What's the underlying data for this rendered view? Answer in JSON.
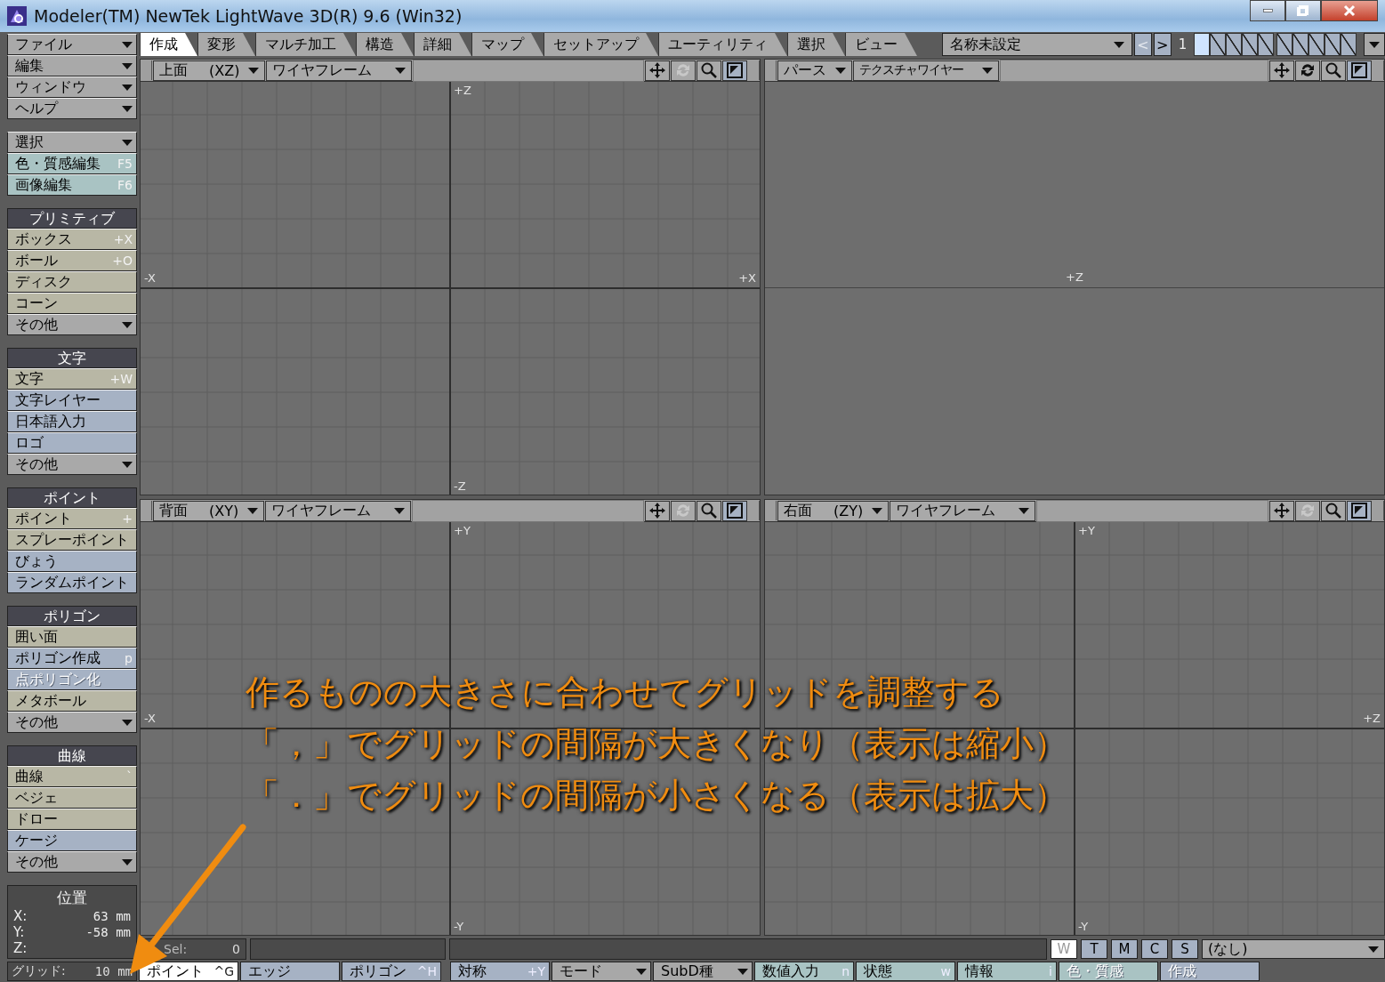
{
  "window": {
    "title": "Modeler(TM) NewTek LightWave 3D(R) 9.6  (Win32)"
  },
  "tabs": [
    {
      "label": "作成",
      "selected": true
    },
    {
      "label": "変形",
      "selected": false
    },
    {
      "label": "マルチ加工",
      "selected": false
    },
    {
      "label": "構造",
      "selected": false
    },
    {
      "label": "詳細",
      "selected": false
    },
    {
      "label": "マップ",
      "selected": false
    },
    {
      "label": "セットアップ",
      "selected": false
    },
    {
      "label": "ユーティリティ",
      "selected": false
    },
    {
      "label": "選択",
      "selected": false
    },
    {
      "label": "ビュー",
      "selected": false
    }
  ],
  "object_menu": {
    "value": "名称未設定"
  },
  "layer_nav": {
    "prev": "<",
    "next": ">",
    "bank": "1"
  },
  "layers": [
    {
      "selected": true
    },
    {
      "selected": false
    },
    {
      "selected": false
    },
    {
      "selected": false
    },
    {
      "selected": false
    },
    {
      "selected": false
    },
    {
      "selected": false
    },
    {
      "selected": false
    },
    {
      "selected": false
    },
    {
      "selected": false
    }
  ],
  "sidebar": {
    "groups": [
      {
        "items": [
          {
            "label": "ファイル",
            "kind": "menu",
            "disabled": false
          },
          {
            "label": "編集",
            "kind": "menu",
            "disabled": false
          },
          {
            "label": "ウィンドウ",
            "kind": "menu",
            "disabled": false
          },
          {
            "label": "ヘルプ",
            "kind": "menu",
            "disabled": false
          }
        ]
      },
      {
        "items": [
          {
            "label": "選択",
            "kind": "menu",
            "disabled": false
          },
          {
            "label": "色・質感編集",
            "shortcut": "F5",
            "kind": "tool",
            "color": "#a9c3c3",
            "disabled": false
          },
          {
            "label": "画像編集",
            "shortcut": "F6",
            "kind": "tool",
            "color": "#a9c3c3",
            "disabled": false
          }
        ]
      },
      {
        "header": "プリミティブ",
        "items": [
          {
            "label": "ボックス",
            "shortcut": "+X",
            "kind": "tool",
            "color": "#b8b7a5",
            "disabled": false
          },
          {
            "label": "ボール",
            "shortcut": "+O",
            "kind": "tool",
            "color": "#b8b7a5",
            "disabled": false
          },
          {
            "label": "ディスク",
            "kind": "tool",
            "color": "#b8b7a5",
            "disabled": false
          },
          {
            "label": "コーン",
            "kind": "tool",
            "color": "#b8b7a5",
            "disabled": false
          },
          {
            "label": "その他",
            "kind": "menu",
            "disabled": false
          }
        ]
      },
      {
        "header": "文字",
        "items": [
          {
            "label": "文字",
            "shortcut": "+W",
            "kind": "tool",
            "color": "#b8b7a5",
            "disabled": false
          },
          {
            "label": "文字レイヤー",
            "kind": "tool",
            "color": "#a6b2c4",
            "disabled": false
          },
          {
            "label": "日本語入力",
            "kind": "tool",
            "color": "#a6b2c4",
            "disabled": false
          },
          {
            "label": "ロゴ",
            "kind": "tool",
            "color": "#a6b2c4",
            "disabled": false
          },
          {
            "label": "その他",
            "kind": "menu",
            "disabled": false
          }
        ]
      },
      {
        "header": "ポイント",
        "items": [
          {
            "label": "ポイント",
            "shortcut": "+",
            "kind": "tool",
            "color": "#b8b7a5",
            "disabled": false
          },
          {
            "label": "スプレーポイント",
            "kind": "tool",
            "color": "#b8b7a5",
            "disabled": false
          },
          {
            "label": "びょう",
            "kind": "tool",
            "color": "#a6b2c4",
            "disabled": false
          },
          {
            "label": "ランダムポイント",
            "kind": "tool",
            "color": "#a6b2c4",
            "disabled": false
          }
        ]
      },
      {
        "header": "ポリゴン",
        "items": [
          {
            "label": "囲い面",
            "kind": "tool",
            "color": "#b8b7a5",
            "disabled": false
          },
          {
            "label": "ポリゴン作成",
            "shortcut": "p",
            "kind": "tool",
            "color": "#a6b2c4",
            "disabled": false
          },
          {
            "label": "点ポリゴン化",
            "kind": "tool",
            "color": "#a6b2c4",
            "disabled": true
          },
          {
            "label": "メタボール",
            "kind": "tool",
            "color": "#b8b7a5",
            "disabled": false
          },
          {
            "label": "その他",
            "kind": "menu",
            "disabled": false
          }
        ]
      },
      {
        "header": "曲線",
        "items": [
          {
            "label": "曲線",
            "shortcut": "`",
            "kind": "tool",
            "color": "#b8b7a5",
            "disabled": false
          },
          {
            "label": "ベジェ",
            "kind": "tool",
            "color": "#b8b7a5",
            "disabled": false
          },
          {
            "label": "ドロー",
            "kind": "tool",
            "color": "#b8b7a5",
            "disabled": false
          },
          {
            "label": "ケージ",
            "kind": "tool",
            "color": "#a6b2c4",
            "disabled": false
          },
          {
            "label": "その他",
            "kind": "menu",
            "disabled": false
          }
        ]
      }
    ]
  },
  "position": {
    "title": "位置",
    "rows": [
      {
        "axis": "X:",
        "value": "63 mm"
      },
      {
        "axis": "Y:",
        "value": "-58 mm"
      },
      {
        "axis": "Z:"
      }
    ]
  },
  "grid": {
    "label": "グリッド:",
    "value": "10 mm"
  },
  "viewports": [
    {
      "view": "上面",
      "axes": "(XZ)",
      "mode": "ワイヤフレーム",
      "rotate_disabled": true,
      "labels": [
        {
          "text": "+Z",
          "kind": "top"
        },
        {
          "text": "-Z",
          "kind": "bottom"
        },
        {
          "text": "-X",
          "kind": "left"
        },
        {
          "text": "+X",
          "kind": "right"
        }
      ]
    },
    {
      "view": "パース",
      "mode": "テクスチャワイヤー",
      "rotate_disabled": false,
      "labels": [
        {
          "text": "+Z",
          "kind": "center"
        }
      ]
    },
    {
      "view": "背面",
      "axes": "(XY)",
      "mode": "ワイヤフレーム",
      "rotate_disabled": true,
      "labels": [
        {
          "text": "+Y",
          "kind": "top"
        },
        {
          "text": "-Y",
          "kind": "bottom"
        },
        {
          "text": "-X",
          "kind": "left"
        }
      ]
    },
    {
      "view": "右面",
      "axes": "(ZY)",
      "mode": "ワイヤフレーム",
      "rotate_disabled": true,
      "labels": [
        {
          "text": "+Y",
          "kind": "top"
        },
        {
          "text": "-Y",
          "kind": "bottom"
        },
        {
          "text": "+Z",
          "kind": "right"
        }
      ]
    }
  ],
  "status": {
    "sel_label": "Sel:",
    "sel_value": "0",
    "wtmcs": [
      {
        "label": "W",
        "selected": true
      },
      {
        "label": "T",
        "selected": false
      },
      {
        "label": "M",
        "selected": false
      },
      {
        "label": "C",
        "selected": false
      },
      {
        "label": "S",
        "selected": false
      }
    ],
    "surface_menu": "(なし)"
  },
  "modes": [
    {
      "label": "ポイント",
      "shortcut": "^G",
      "selected": true
    },
    {
      "label": "エッジ",
      "selected": false
    },
    {
      "label": "ポリゴン",
      "shortcut": "^H",
      "selected": false
    }
  ],
  "tools": [
    {
      "label": "対称",
      "shortcut": "+Y",
      "kind": "button",
      "color": "#a6b2c4",
      "disabled": false
    },
    {
      "label": "モード",
      "kind": "menu",
      "color": "#a8a8a8",
      "disabled": false
    },
    {
      "label": "SubD種",
      "kind": "menu",
      "color": "#a8a8a8",
      "disabled": false
    },
    {
      "label": "数値入力",
      "shortcut": "n",
      "kind": "button",
      "color": "#a9c3c3",
      "disabled": false
    },
    {
      "label": "状態",
      "shortcut": "w",
      "kind": "button",
      "color": "#a9c3c3",
      "disabled": false
    },
    {
      "label": "情報",
      "shortcut": "i",
      "kind": "button",
      "color": "#a9c3c3",
      "disabled": false
    },
    {
      "label": "色・質感",
      "kind": "button",
      "color": "#a9c3c3",
      "disabled": true
    },
    {
      "label": "作成",
      "kind": "button",
      "color": "#a6b2c4",
      "disabled": true
    }
  ],
  "annotation": {
    "lines": [
      "作るものの大きさに合わせてグリッドを調整する",
      "「，」でグリッドの間隔が大きくなり（表示は縮小）",
      "「．」でグリッドの間隔が小さくなる（表示は拡大）"
    ]
  }
}
